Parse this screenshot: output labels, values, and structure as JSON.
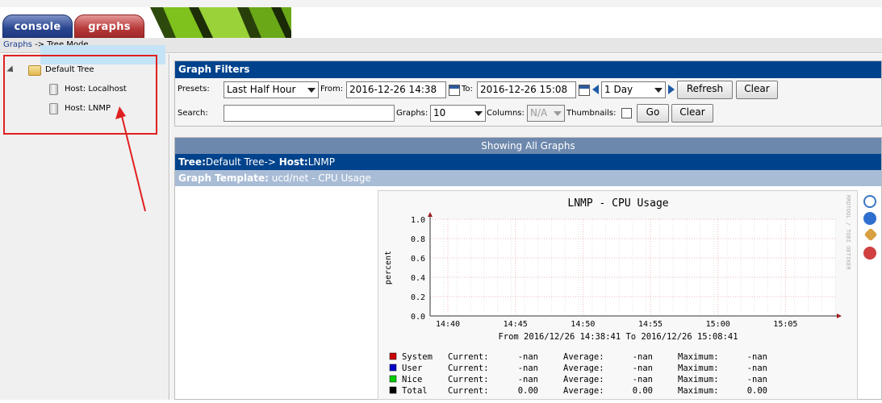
{
  "header": {
    "tabs": [
      {
        "label": "console",
        "color": "#2a4690"
      },
      {
        "label": "graphs",
        "color": "#b83a3a"
      }
    ]
  },
  "breadcrumb": {
    "link": "Graphs",
    "separator": "->",
    "current": "Tree Mode"
  },
  "tree": {
    "root": "Default Tree",
    "hosts": [
      "Host: Localhost",
      "Host: LNMP"
    ],
    "selected_index": 1
  },
  "filters": {
    "title": "Graph Filters",
    "presets_label": "Presets:",
    "presets_value": "Last Half Hour",
    "from_label": "From:",
    "from_value": "2016-12-26 14:38",
    "to_label": "To:",
    "to_value": "2016-12-26 15:08",
    "timespan_value": "1 Day",
    "refresh_label": "Refresh",
    "clear_label": "Clear",
    "search_label": "Search:",
    "search_value": "",
    "graphs_label": "Graphs:",
    "graphs_value": "10",
    "columns_label": "Columns:",
    "columns_value": "N/A",
    "thumbnails_label": "Thumbnails:",
    "go_label": "Go",
    "clear2_label": "Clear"
  },
  "section": {
    "showing": "Showing All Graphs",
    "tree_label": "Tree:",
    "tree_value": "Default Tree->",
    "host_label": "Host:",
    "host_value": "LNMP",
    "template_label": "Graph Template:",
    "template_value": "ucd/net - CPU Usage"
  },
  "graph": {
    "watermark": "RRDTOOL / TOBI OETIKER",
    "from_to": "From 2016/12/26 14:38:41 To 2016/12/26 15:08:41",
    "legend": [
      {
        "color": "#cc0000",
        "name": "System",
        "current": "-nan",
        "average": "-nan",
        "maximum": "-nan"
      },
      {
        "color": "#0000cc",
        "name": "User",
        "current": "-nan",
        "average": "-nan",
        "maximum": "-nan"
      },
      {
        "color": "#00cc00",
        "name": "Nice",
        "current": "-nan",
        "average": "-nan",
        "maximum": "-nan"
      },
      {
        "color": "#000000",
        "name": "Total",
        "current": "0.00",
        "average": "0.00",
        "maximum": "0.00"
      }
    ],
    "legend_labels": {
      "current": "Current:",
      "average": "Average:",
      "maximum": "Maximum:"
    }
  },
  "chart_data": {
    "type": "line",
    "title": "LNMP - CPU Usage",
    "xlabel": "",
    "ylabel": "percent",
    "x_ticks": [
      "14:40",
      "14:45",
      "14:50",
      "14:55",
      "15:00",
      "15:05"
    ],
    "y_ticks": [
      "0.0",
      "0.2",
      "0.4",
      "0.6",
      "0.8",
      "1.0"
    ],
    "ylim": [
      0,
      1.0
    ],
    "grid": true,
    "series": [
      {
        "name": "System",
        "values": []
      },
      {
        "name": "User",
        "values": []
      },
      {
        "name": "Nice",
        "values": []
      },
      {
        "name": "Total",
        "values": [
          0,
          0,
          0,
          0,
          0,
          0
        ]
      }
    ]
  }
}
